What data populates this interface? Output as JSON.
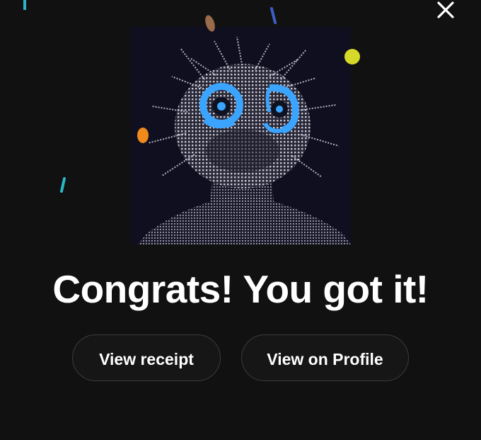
{
  "dialog": {
    "close_icon": "close-icon",
    "headline": "Congrats! You got it!",
    "artwork": {
      "subject": "pixel-portrait",
      "background": "#100f20",
      "eye_color": "#3aa4ff"
    },
    "buttons": {
      "view_receipt": "View receipt",
      "view_on_profile": "View on Profile"
    }
  },
  "colors": {
    "background": "#111111",
    "button_border": "#3b3b3b",
    "confetti": [
      "#2bb5c8",
      "#9a6b4b",
      "#3d5fc4",
      "#d6d92a",
      "#f08a1c"
    ]
  }
}
